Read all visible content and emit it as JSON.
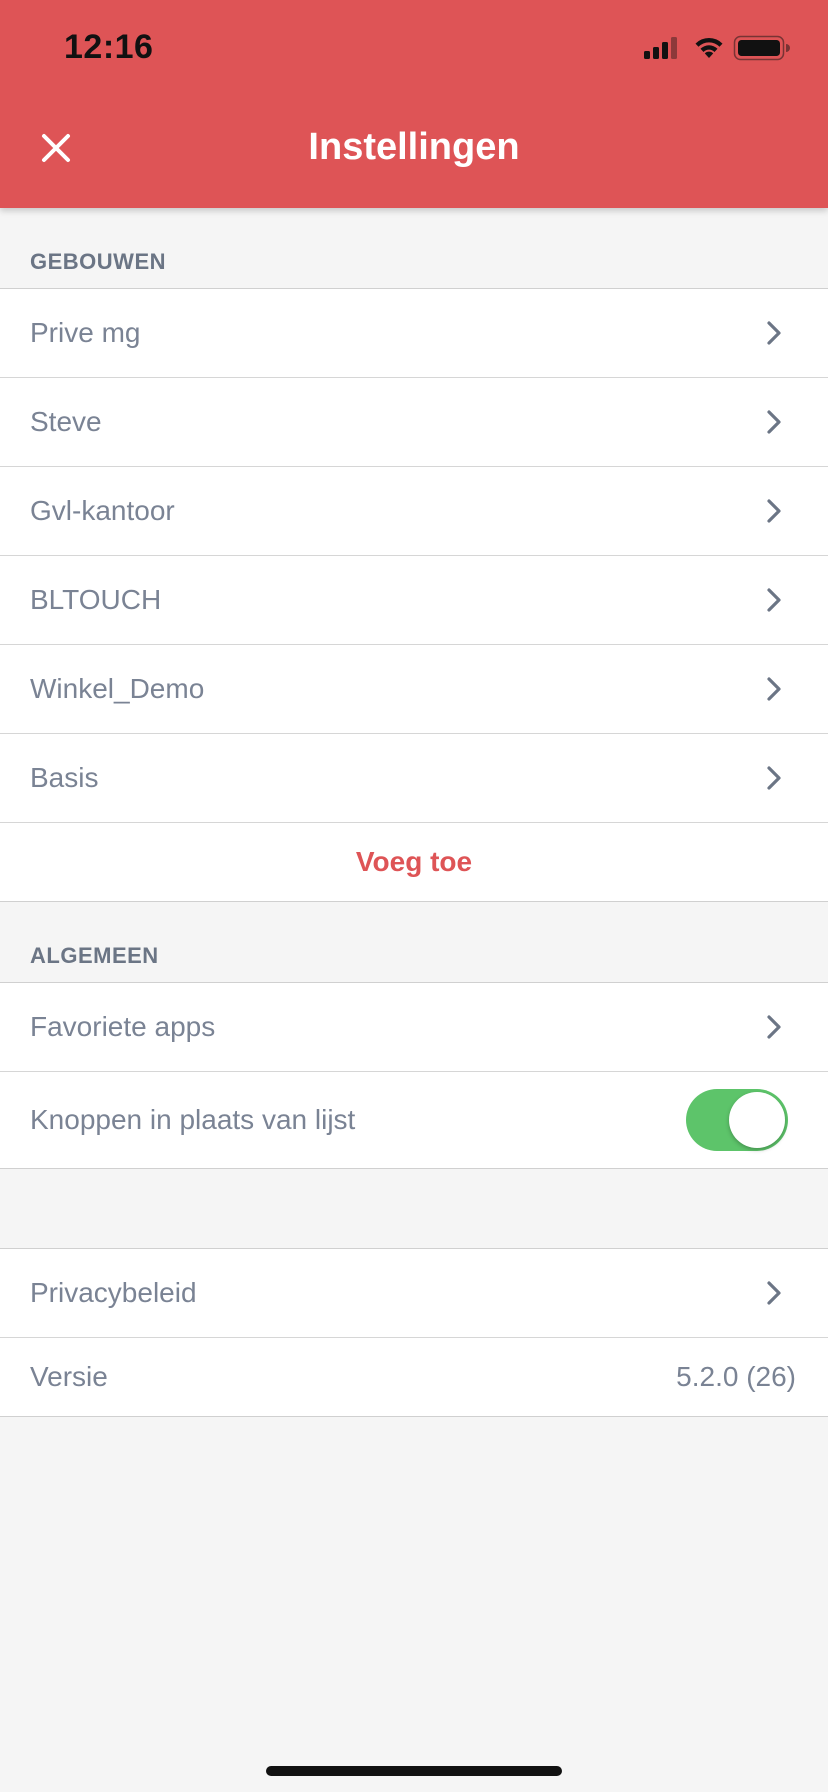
{
  "status_bar": {
    "time": "12:16"
  },
  "header": {
    "title": "Instellingen"
  },
  "buildings": {
    "section_title": "GEBOUWEN",
    "items": [
      {
        "label": "Prive mg"
      },
      {
        "label": "Steve"
      },
      {
        "label": "Gvl-kantoor"
      },
      {
        "label": "BLTOUCH"
      },
      {
        "label": "Winkel_Demo"
      },
      {
        "label": "Basis"
      }
    ],
    "add_label": "Voeg toe"
  },
  "general": {
    "section_title": "ALGEMEEN",
    "favorite_apps_label": "Favoriete apps",
    "buttons_toggle": {
      "label": "Knoppen in plaats van lijst",
      "on": true
    }
  },
  "info": {
    "privacy_label": "Privacybeleid",
    "version_label": "Versie",
    "version_value": "5.2.0 (26)"
  },
  "colors": {
    "accent": "#de5456",
    "toggle_on": "#5dc46a",
    "text_muted": "#7a8394",
    "background": "#f5f5f5"
  },
  "icons": [
    "close-icon",
    "signal-icon",
    "wifi-icon",
    "battery-icon",
    "chevron-right-icon"
  ]
}
